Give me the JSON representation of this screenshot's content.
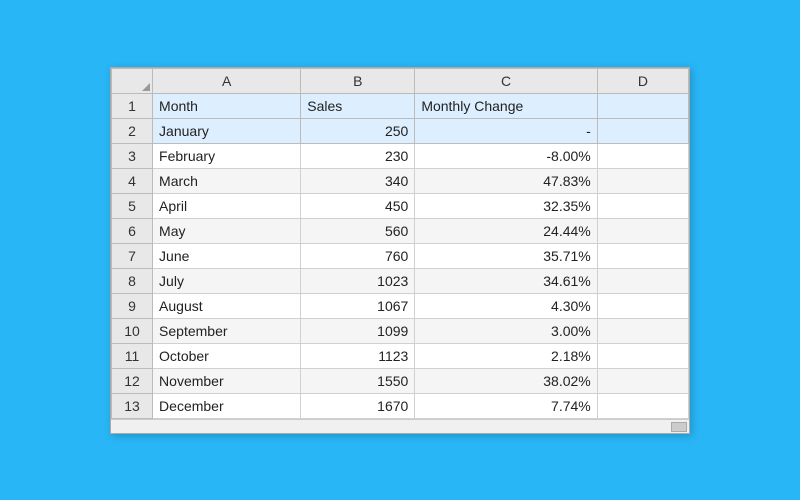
{
  "spreadsheet": {
    "columns": [
      "",
      "A",
      "B",
      "C",
      "D"
    ],
    "headers": {
      "col_a": "Month",
      "col_b": "Sales",
      "col_c": "Monthly Change"
    },
    "rows": [
      {
        "num": "2",
        "month": "January",
        "sales": "250",
        "change": "-"
      },
      {
        "num": "3",
        "month": "February",
        "sales": "230",
        "change": "-8.00%"
      },
      {
        "num": "4",
        "month": "March",
        "sales": "340",
        "change": "47.83%"
      },
      {
        "num": "5",
        "month": "April",
        "sales": "450",
        "change": "32.35%"
      },
      {
        "num": "6",
        "month": "May",
        "sales": "560",
        "change": "24.44%"
      },
      {
        "num": "7",
        "month": "June",
        "sales": "760",
        "change": "35.71%"
      },
      {
        "num": "8",
        "month": "July",
        "sales": "1023",
        "change": "34.61%"
      },
      {
        "num": "9",
        "month": "August",
        "sales": "1067",
        "change": "4.30%"
      },
      {
        "num": "10",
        "month": "September",
        "sales": "1099",
        "change": "3.00%"
      },
      {
        "num": "11",
        "month": "October",
        "sales": "1123",
        "change": "2.18%"
      },
      {
        "num": "12",
        "month": "November",
        "sales": "1550",
        "change": "38.02%"
      },
      {
        "num": "13",
        "month": "December",
        "sales": "1670",
        "change": "7.74%"
      }
    ]
  }
}
